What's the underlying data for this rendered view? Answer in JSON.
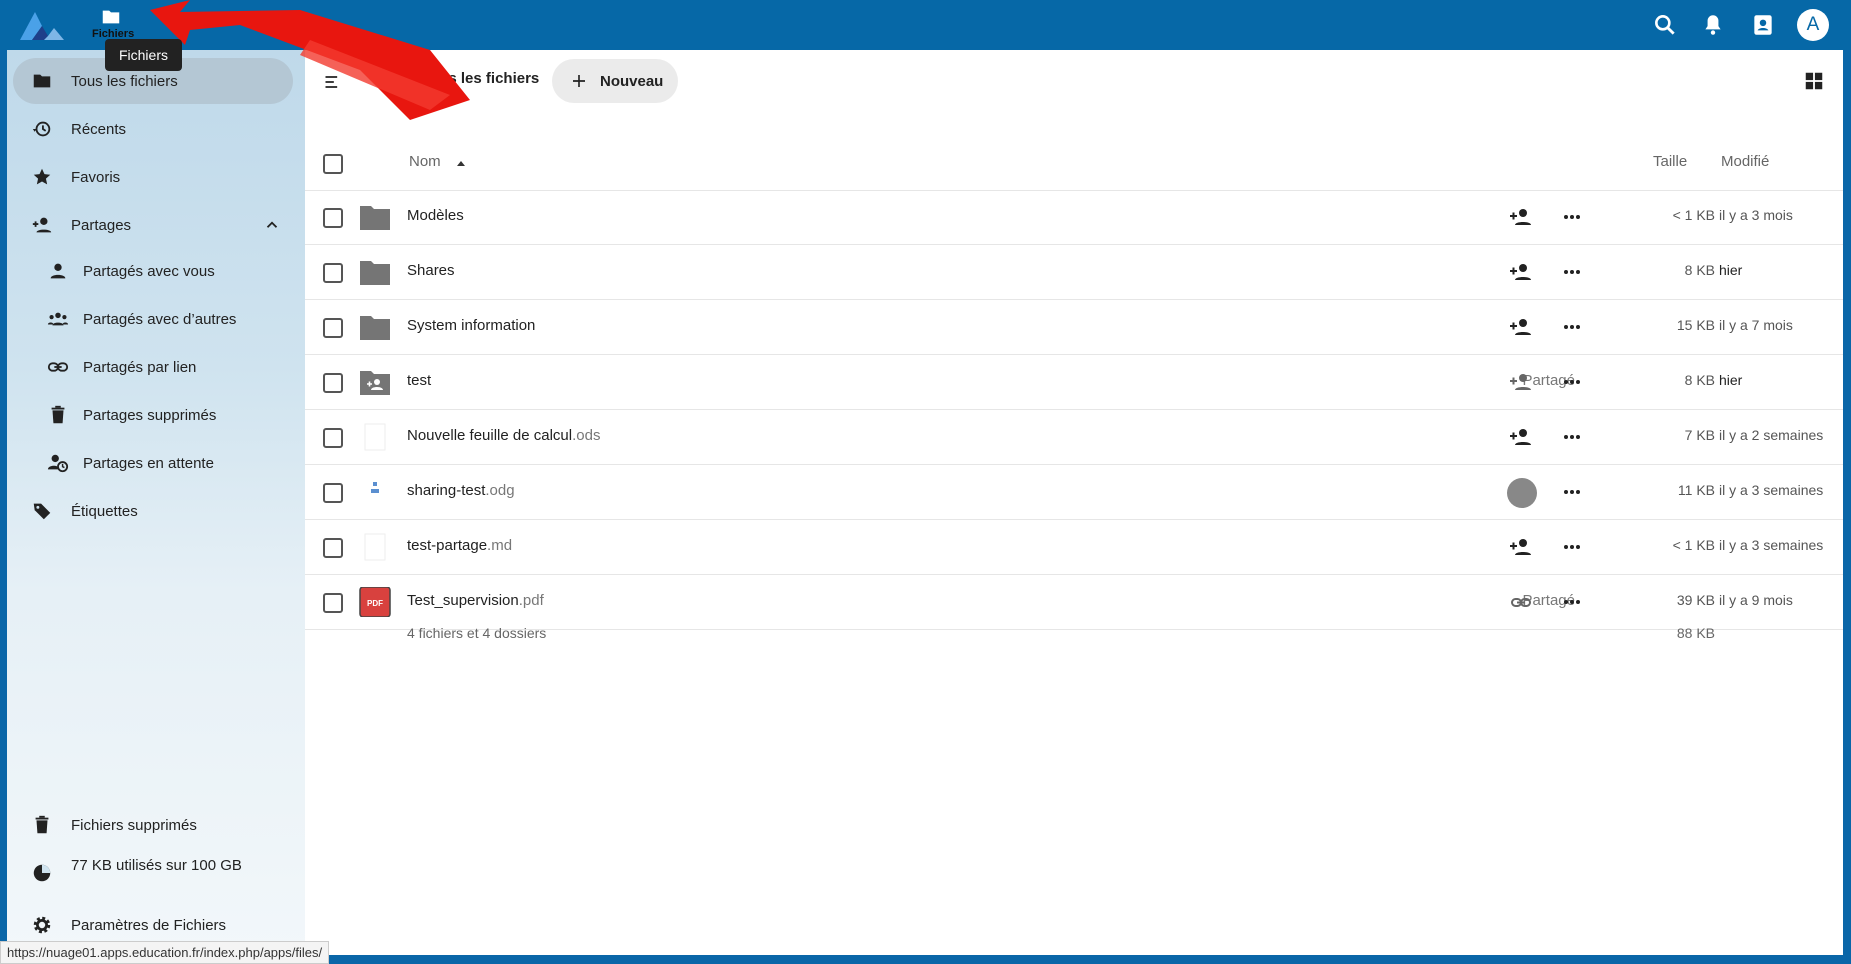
{
  "header": {
    "app_label": "Fichiers",
    "tooltip": "Fichiers",
    "avatar_letter": "A"
  },
  "sidebar": {
    "items": [
      {
        "label": "Tous les fichiers",
        "icon": "folder-icon"
      },
      {
        "label": "Récents",
        "icon": "history-icon"
      },
      {
        "label": "Favoris",
        "icon": "star-icon"
      },
      {
        "label": "Partages",
        "icon": "account-plus-icon"
      },
      {
        "label": "Partagés avec vous",
        "icon": "account-icon"
      },
      {
        "label": "Partagés avec d’autres",
        "icon": "account-group-icon"
      },
      {
        "label": "Partagés par lien",
        "icon": "link-icon"
      },
      {
        "label": "Partages supprimés",
        "icon": "trash-icon"
      },
      {
        "label": "Partages en attente",
        "icon": "account-clock-icon"
      },
      {
        "label": "Étiquettes",
        "icon": "tag-icon"
      }
    ],
    "footer": {
      "deleted": "Fichiers supprimés",
      "quota": "77 KB utilisés sur 100 GB",
      "settings": "Paramètres de Fichiers"
    }
  },
  "main": {
    "breadcrumb": "Tous les fichiers",
    "new_button": "Nouveau",
    "columns": {
      "name": "Nom",
      "size": "Taille",
      "modified": "Modifié"
    },
    "files": [
      {
        "name": "Modèles",
        "ext": "",
        "size": "< 1 KB",
        "modified": "il y a 3 mois",
        "shared": ""
      },
      {
        "name": "Shares",
        "ext": "",
        "size": "8 KB",
        "modified": "hier",
        "shared": ""
      },
      {
        "name": "System information",
        "ext": "",
        "size": "15 KB",
        "modified": "il y a 7 mois",
        "shared": ""
      },
      {
        "name": "test",
        "ext": "",
        "size": "8 KB",
        "modified": "hier",
        "shared": "Partagé"
      },
      {
        "name": "Nouvelle feuille de calcul",
        "ext": ".ods",
        "size": "7 KB",
        "modified": "il y a 2 semaines",
        "shared": ""
      },
      {
        "name": "sharing-test",
        "ext": ".odg",
        "size": "11 KB",
        "modified": "il y a 3 semaines",
        "shared": ""
      },
      {
        "name": "test-partage",
        "ext": ".md",
        "size": "< 1 KB",
        "modified": "il y a 3 semaines",
        "shared": ""
      },
      {
        "name": "Test_supervision",
        "ext": ".pdf",
        "size": "39 KB",
        "modified": "il y a 9 mois",
        "shared": "Partagé"
      }
    ],
    "summary": "4 fichiers et 4 dossiers",
    "summary_size": "88 KB"
  },
  "statusbar": "https://nuage01.apps.education.fr/index.php/apps/files/",
  "colors": {
    "header": "#0668a7",
    "active_nav": "#b4c7d4",
    "pdf": "#d8413e"
  }
}
